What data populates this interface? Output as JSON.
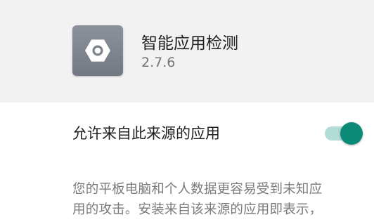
{
  "app": {
    "name": "智能应用检测",
    "version": "2.7.6",
    "icon": "gear-icon"
  },
  "setting": {
    "label": "允许来自此来源的应用",
    "toggle_state": "on",
    "toggle_color": "#0b8a77"
  },
  "description": {
    "line1": "您的平板电脑和个人数据更容易受到未知应",
    "line2": "用的攻击。安装来自该来源的应用即表示，"
  }
}
